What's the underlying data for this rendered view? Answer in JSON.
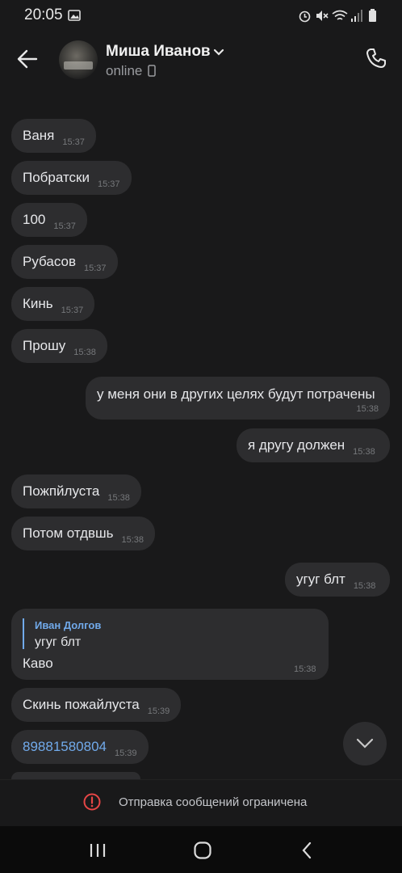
{
  "status_bar": {
    "time": "20:05"
  },
  "header": {
    "name": "Миша Иванов",
    "presence": "online"
  },
  "messages": [
    {
      "text": "Ваня",
      "time": "15:37",
      "side": "in"
    },
    {
      "text": "Побратски",
      "time": "15:37",
      "side": "in"
    },
    {
      "text": "100",
      "time": "15:37",
      "side": "in"
    },
    {
      "text": "Рубасов",
      "time": "15:37",
      "side": "in"
    },
    {
      "text": "Кинь",
      "time": "15:37",
      "side": "in"
    },
    {
      "text": "Прошу",
      "time": "15:38",
      "side": "in"
    },
    {
      "text": "у меня они в других целях будут потрачены",
      "time": "15:38",
      "side": "out"
    },
    {
      "text": "я другу должен",
      "time": "15:38",
      "side": "out"
    },
    {
      "text": "Пожпйлуста",
      "time": "15:38",
      "side": "in"
    },
    {
      "text": "Потом отдвшь",
      "time": "15:38",
      "side": "in"
    },
    {
      "text": "угуг блт",
      "time": "15:38",
      "side": "out"
    },
    {
      "reply_author": "Иван Долгов",
      "reply_text": "угуг блт",
      "text": "Каво",
      "time": "15:38",
      "side": "in"
    },
    {
      "text": "Скинь пожайлуста",
      "time": "15:39",
      "side": "in"
    },
    {
      "text": "89881580804",
      "time": "15:39",
      "side": "in",
      "is_phone": true
    }
  ],
  "footer": {
    "restriction_text": "Отправка сообщений ограничена"
  },
  "colors": {
    "background": "#19191a",
    "bubble": "#2d2d2f",
    "accent": "#71aaeb",
    "warning": "#e64646"
  },
  "icons": [
    "back-arrow-icon",
    "chevron-down-icon",
    "phone-icon",
    "mobile-icon",
    "scroll-down-icon",
    "warning-icon",
    "recent-apps-icon",
    "home-icon",
    "back-icon",
    "alarm-icon",
    "mute-icon",
    "wifi-icon",
    "signal-icon",
    "battery-icon",
    "image-icon"
  ]
}
